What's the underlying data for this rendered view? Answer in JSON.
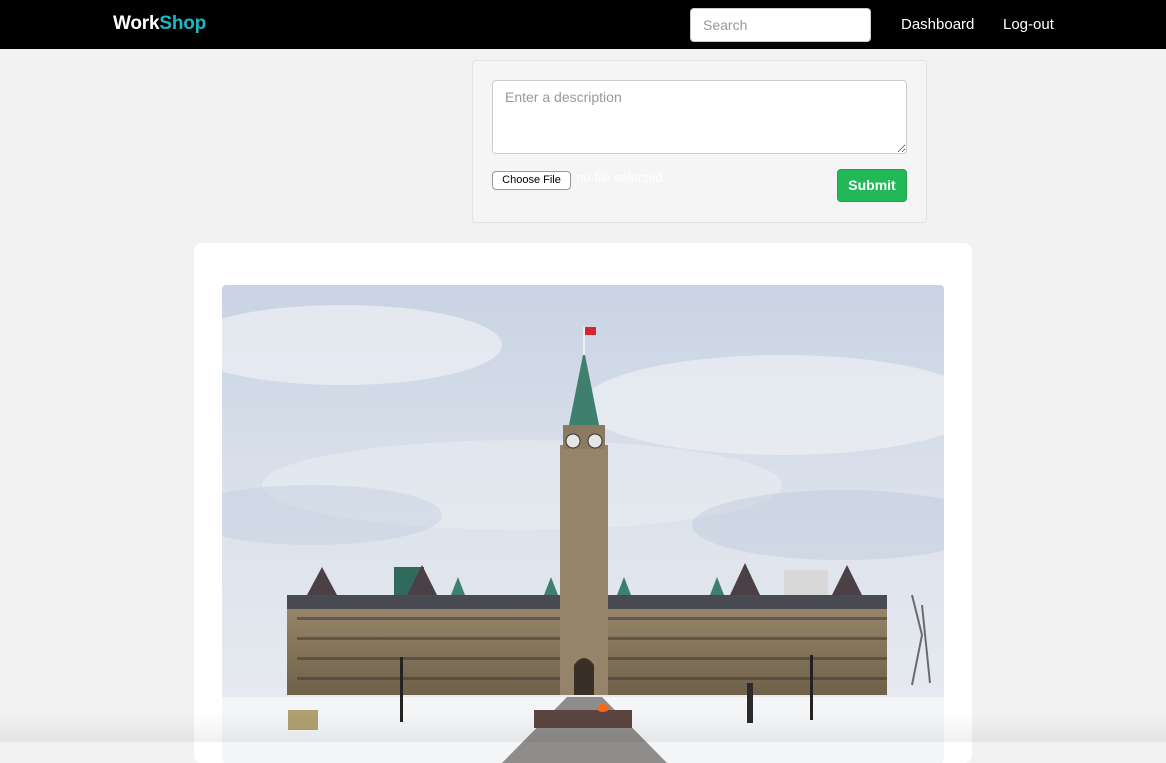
{
  "navbar": {
    "brand_part1": "Work",
    "brand_part2": "Shop",
    "search_placeholder": "Search",
    "links": [
      "Dashboard",
      "Log-out"
    ]
  },
  "post_form": {
    "description_placeholder": "Enter a description",
    "choose_file_label": "Choose File",
    "no_file_text": "no file selected",
    "submit_label": "Submit"
  },
  "colors": {
    "navbar_bg": "#000000",
    "brand_accent": "#1bb8c5",
    "submit_green": "#21b957",
    "page_bg": "#f2f2f2"
  }
}
